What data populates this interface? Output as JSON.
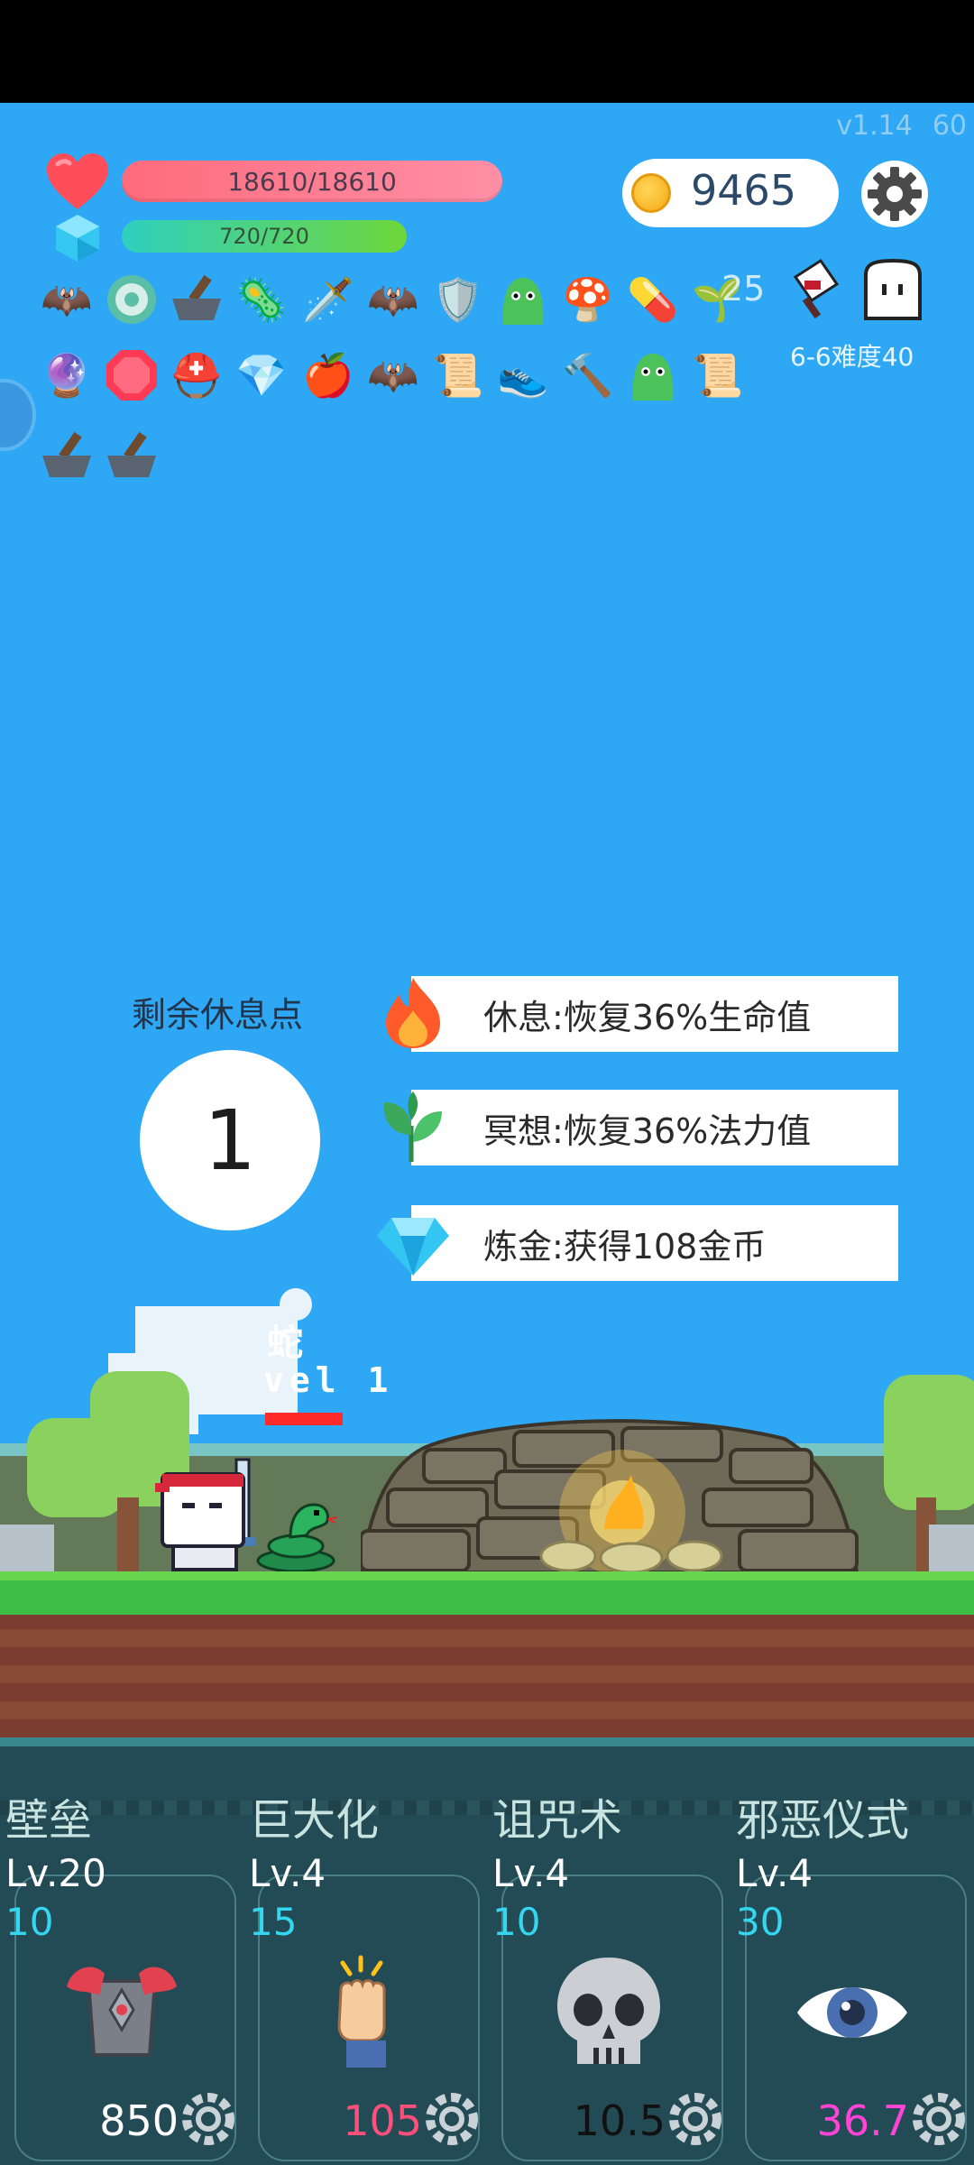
{
  "version": "v1.14",
  "fps": "60",
  "hp": {
    "text": "18610/18610",
    "fraction": 1.0
  },
  "mp": {
    "text": "720/720",
    "fraction": 1.0
  },
  "coins": "9465",
  "relic_count": "25",
  "stage": "6-6难度40",
  "relics_row1": [
    "bat-icon",
    "shield-ring-icon",
    "mortar-icon",
    "green-virus-icon",
    "sword-icon",
    "bat-icon",
    "shield-icon",
    "slime-icon",
    "mushroom-icon",
    "pill-icon",
    "tree-icon"
  ],
  "relics_row2": [
    "crystal-ball-icon",
    "ruby-icon",
    "helmet-icon",
    "diamond-icon",
    "apple-icon",
    "bat-icon",
    "scroll-icon",
    "shoe-icon",
    "hammer-icon",
    "slime-icon",
    "scroll-icon"
  ],
  "relics_row3": [
    "mortar-icon",
    "mortar-icon"
  ],
  "rest": {
    "label": "剩余休息点",
    "points": "1",
    "options": [
      {
        "icon": "fire-icon",
        "text": "休息:恢复36%生命值"
      },
      {
        "icon": "leaf-icon",
        "text": "冥想:恢复36%法力值"
      },
      {
        "icon": "diamond-icon",
        "text": "炼金:获得108金币"
      }
    ]
  },
  "enemy": {
    "name": "蛇",
    "level_text": "vel 1"
  },
  "skills": [
    {
      "name": "壁垒",
      "level": "Lv.20",
      "cost": "10",
      "value": "850",
      "value_color": "#ffffff",
      "icon": "armor-icon"
    },
    {
      "name": "巨大化",
      "level": "Lv.4",
      "cost": "15",
      "value": "105",
      "value_color": "#ff4f7a",
      "icon": "fist-icon"
    },
    {
      "name": "诅咒术",
      "level": "Lv.4",
      "cost": "10",
      "value": "10.5",
      "value_color": "#111111",
      "icon": "skull-icon"
    },
    {
      "name": "邪恶仪式",
      "level": "Lv.4",
      "cost": "30",
      "value": "36.7",
      "value_color": "#ff44d6",
      "icon": "eye-icon"
    }
  ]
}
